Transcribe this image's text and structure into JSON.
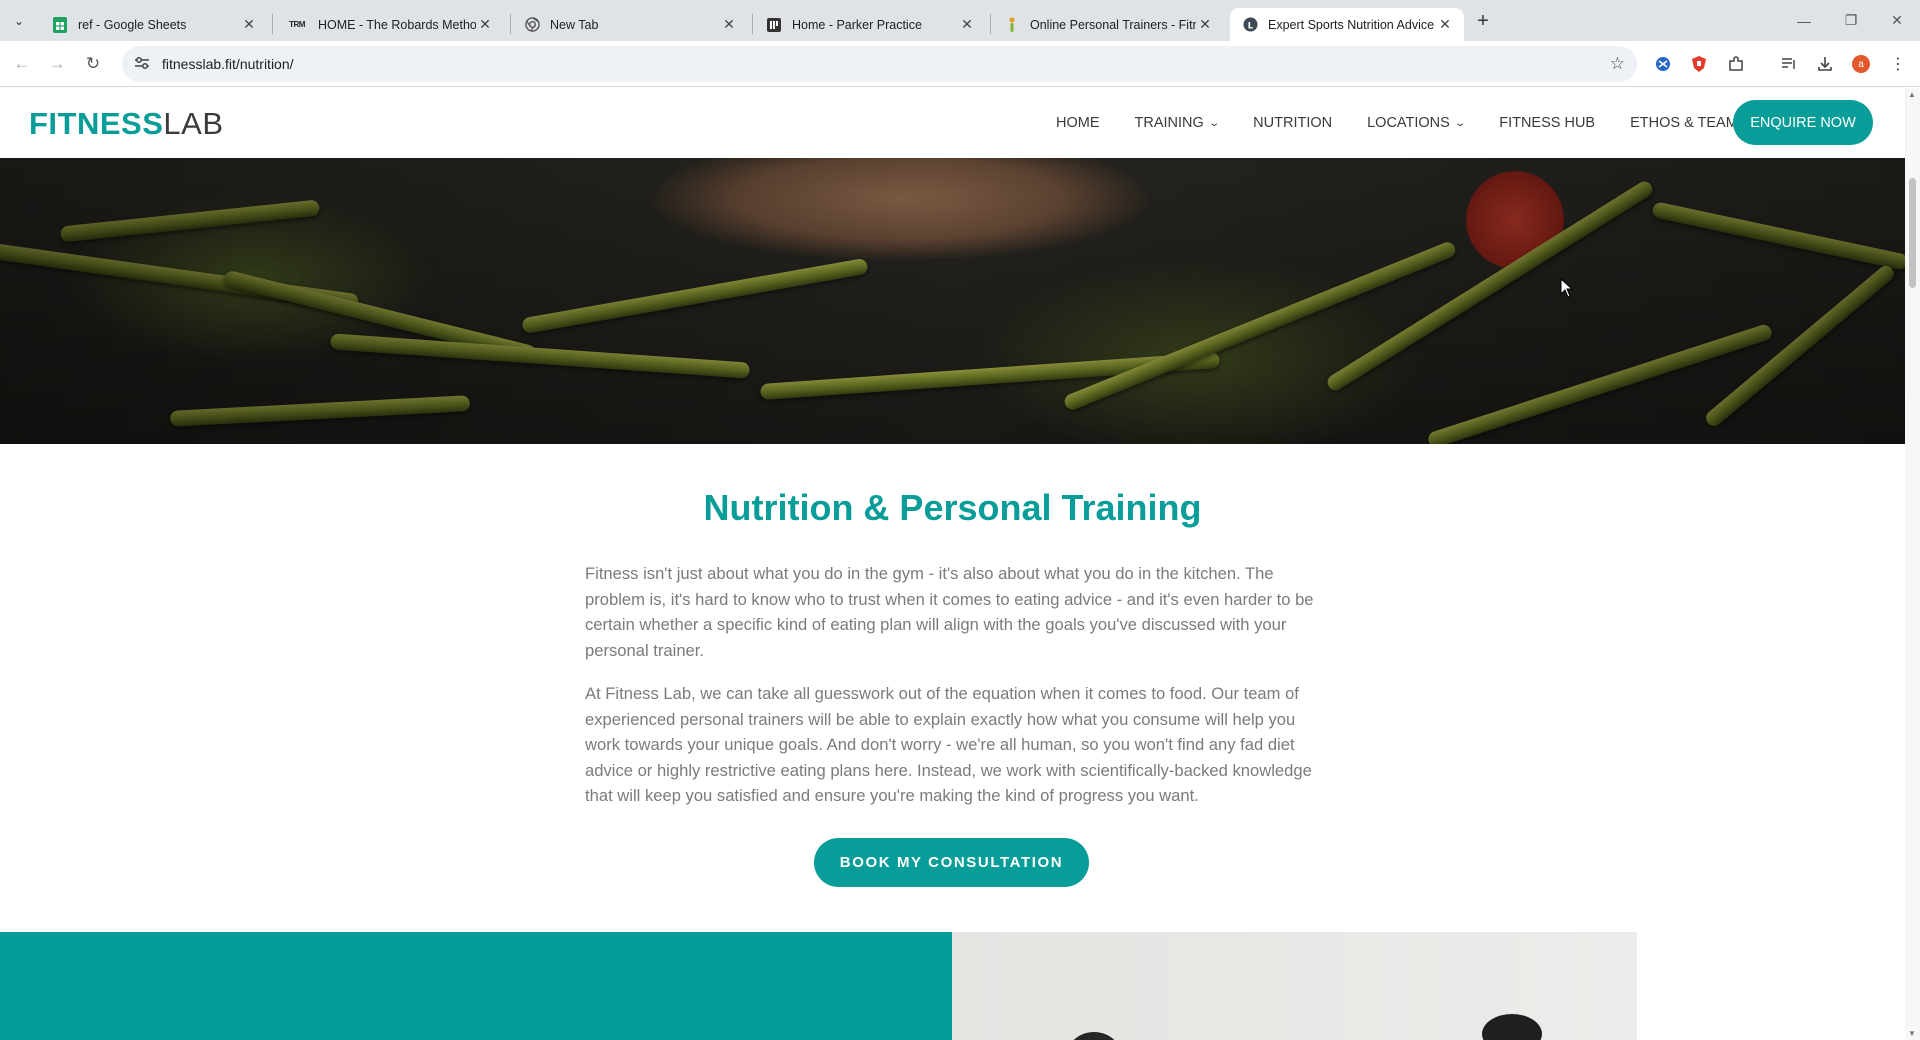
{
  "browser": {
    "tabs": [
      {
        "title": "ref - Google Sheets",
        "favicon": "sheets-icon",
        "active": false
      },
      {
        "title": "HOME - The Robards Method",
        "favicon": "trm-icon",
        "active": false
      },
      {
        "title": "New Tab",
        "favicon": "chrome-icon",
        "active": false
      },
      {
        "title": "Home - Parker Practice",
        "favicon": "parker-icon",
        "active": false
      },
      {
        "title": "Online Personal Trainers - Fitne",
        "favicon": "fitness-icon",
        "active": false
      },
      {
        "title": "Expert Sports Nutrition Advice",
        "favicon": "fitnesslab-icon",
        "active": true
      }
    ],
    "trm_favicon_text": "TRM",
    "url": "fitnesslab.fit/nutrition/",
    "profile_initial": "a"
  },
  "site": {
    "logo_bold": "FITNESS",
    "logo_light": "LAB",
    "nav": [
      {
        "label": "HOME",
        "dropdown": false
      },
      {
        "label": "TRAINING",
        "dropdown": true
      },
      {
        "label": "NUTRITION",
        "dropdown": false
      },
      {
        "label": "LOCATIONS",
        "dropdown": true
      },
      {
        "label": "FITNESS HUB",
        "dropdown": false
      },
      {
        "label": "ETHOS & TEAM",
        "dropdown": true
      }
    ],
    "enquire_label": "ENQUIRE NOW",
    "section_title": "Nutrition & Personal Training",
    "paragraph_1": "Fitness isn't just about what you do in the gym - it's also about what you do in the kitchen. The problem is, it's hard to know who to trust when it comes to eating advice - and it's even harder to be certain whether a specific kind of eating plan will align with the goals you've discussed with your personal trainer.",
    "paragraph_2": "At Fitness Lab, we can take all guesswork out of the equation when it comes to food. Our team of experienced personal trainers will be able to explain exactly how what you consume will help you work towards your unique goals. And don't worry - we're all human, so you won't find any fad diet advice or highly restrictive eating plans here. Instead, we work with scientifically-backed knowledge that will keep you satisfied and ensure you're making the kind of progress you want.",
    "cta_label": "BOOK MY CONSULTATION"
  },
  "colors": {
    "brand_teal": "#089d99",
    "chrome_bg": "#dfe3e8"
  }
}
